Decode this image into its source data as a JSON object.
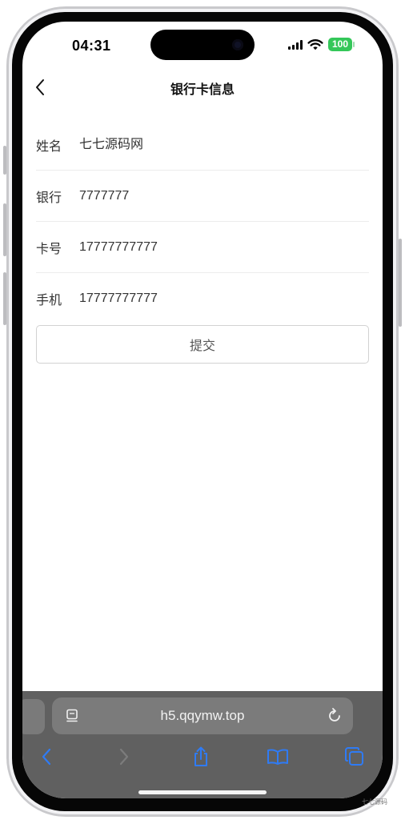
{
  "status": {
    "time": "04:31",
    "battery": "100"
  },
  "nav": {
    "title": "银行卡信息",
    "back_icon": "chevron-left-icon"
  },
  "form": {
    "fields": [
      {
        "label": "姓名",
        "value": "七七源码网"
      },
      {
        "label": "银行",
        "value": "7777777"
      },
      {
        "label": "卡号",
        "value": "17777777777"
      },
      {
        "label": "手机",
        "value": "17777777777"
      }
    ],
    "submit_label": "提交"
  },
  "browser": {
    "url": "h5.qqymw.top",
    "toolbar_icons": [
      "back-icon",
      "forward-icon",
      "share-icon",
      "bookmarks-icon",
      "tabs-icon"
    ]
  },
  "watermark": "七七源码",
  "colors": {
    "accent_blue": "#2f7bf5",
    "battery_green": "#34c759",
    "safari_bar": "#606060"
  }
}
